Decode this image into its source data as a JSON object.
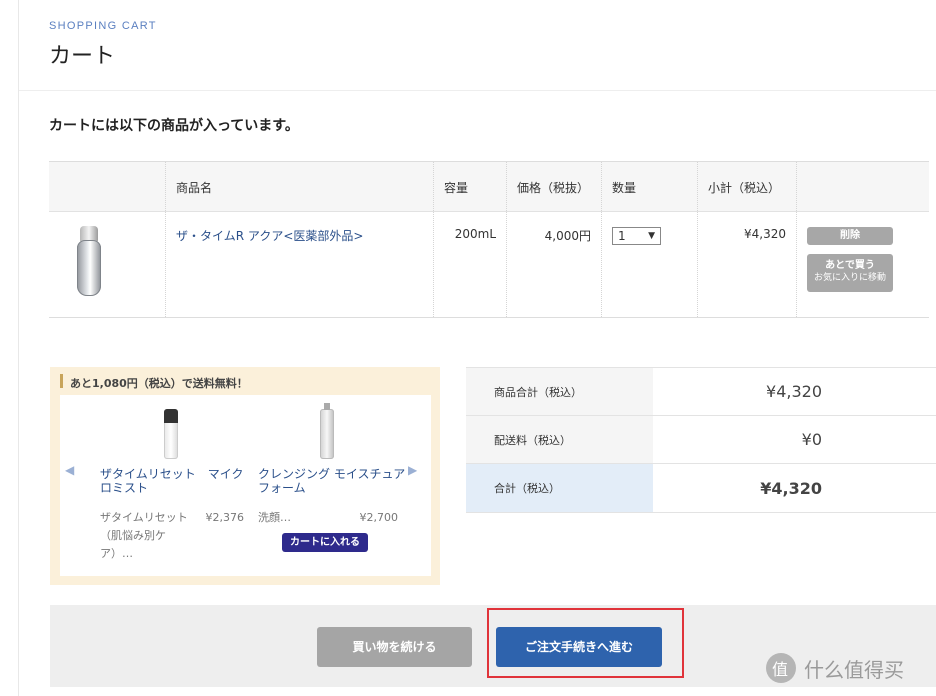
{
  "header": {
    "eyebrow": "SHOPPING CART",
    "title": "カート"
  },
  "intro": "カートには以下の商品が入っています。",
  "cart_table": {
    "columns": [
      "商品名",
      "容量",
      "価格（税抜）",
      "数量",
      "小計（税込）"
    ],
    "items": [
      {
        "name": "ザ・タイムR アクア<医薬部外品>",
        "volume": "200mL",
        "price": "4,000円",
        "quantity": "1",
        "subtotal": "¥4,320",
        "delete_label": "削除",
        "later_label": "あとで買う",
        "later_sub": "お気に入りに移動"
      }
    ]
  },
  "shipping_panel": {
    "title": "あと1,080円（税込）で送料無料！",
    "products": [
      {
        "name": "ザタイムリセット　マイクロミスト",
        "desc": "ザタイムリセット（肌悩み別ケア）…",
        "price": "¥2,376"
      },
      {
        "name": "クレンジング モイスチュアフォーム",
        "desc": "洗顔…",
        "price": "¥2,700",
        "button": "カートに入れる"
      }
    ],
    "prev_icon": "◀",
    "next_icon": "▶"
  },
  "totals": {
    "rows": [
      {
        "label": "商品合計（税込）",
        "value": "¥4,320"
      },
      {
        "label": "配送料（税込）",
        "value": "¥0"
      },
      {
        "label": "合計（税込）",
        "value": "¥4,320"
      }
    ]
  },
  "actions": {
    "continue_label": "買い物を続ける",
    "checkout_label": "ご注文手続きへ進む"
  },
  "watermark": {
    "text": "什么值得买"
  },
  "colors": {
    "accent_blue": "#2e63ad",
    "link": "#2a4f8a",
    "highlight": "#e0333a",
    "panel_bg": "#fbf0da"
  }
}
